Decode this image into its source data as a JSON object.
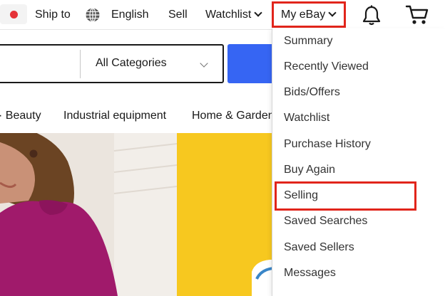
{
  "header": {
    "ship_to": "Ship to",
    "language": "English",
    "sell": "Sell",
    "watchlist": "Watchlist",
    "my_ebay": "My eBay",
    "icons": [
      "flag-icon",
      "globe-icon",
      "chevron-down-icon",
      "bell-icon",
      "cart-icon"
    ]
  },
  "search": {
    "category": "All Categories"
  },
  "nav": {
    "items": [
      "· Beauty",
      "Industrial equipment",
      "Home & Garden"
    ]
  },
  "dropdown": {
    "items": [
      "Summary",
      "Recently Viewed",
      "Bids/Offers",
      "Watchlist",
      "Purchase History",
      "Buy Again",
      "Selling",
      "Saved Searches",
      "Saved Sellers",
      "Messages"
    ]
  },
  "colors": {
    "highlight": "#e1251b",
    "search_button": "#3665f3",
    "hero_yellow": "#f7c81f",
    "sweater": "#a01a6b",
    "flag_red": "#e53238"
  }
}
